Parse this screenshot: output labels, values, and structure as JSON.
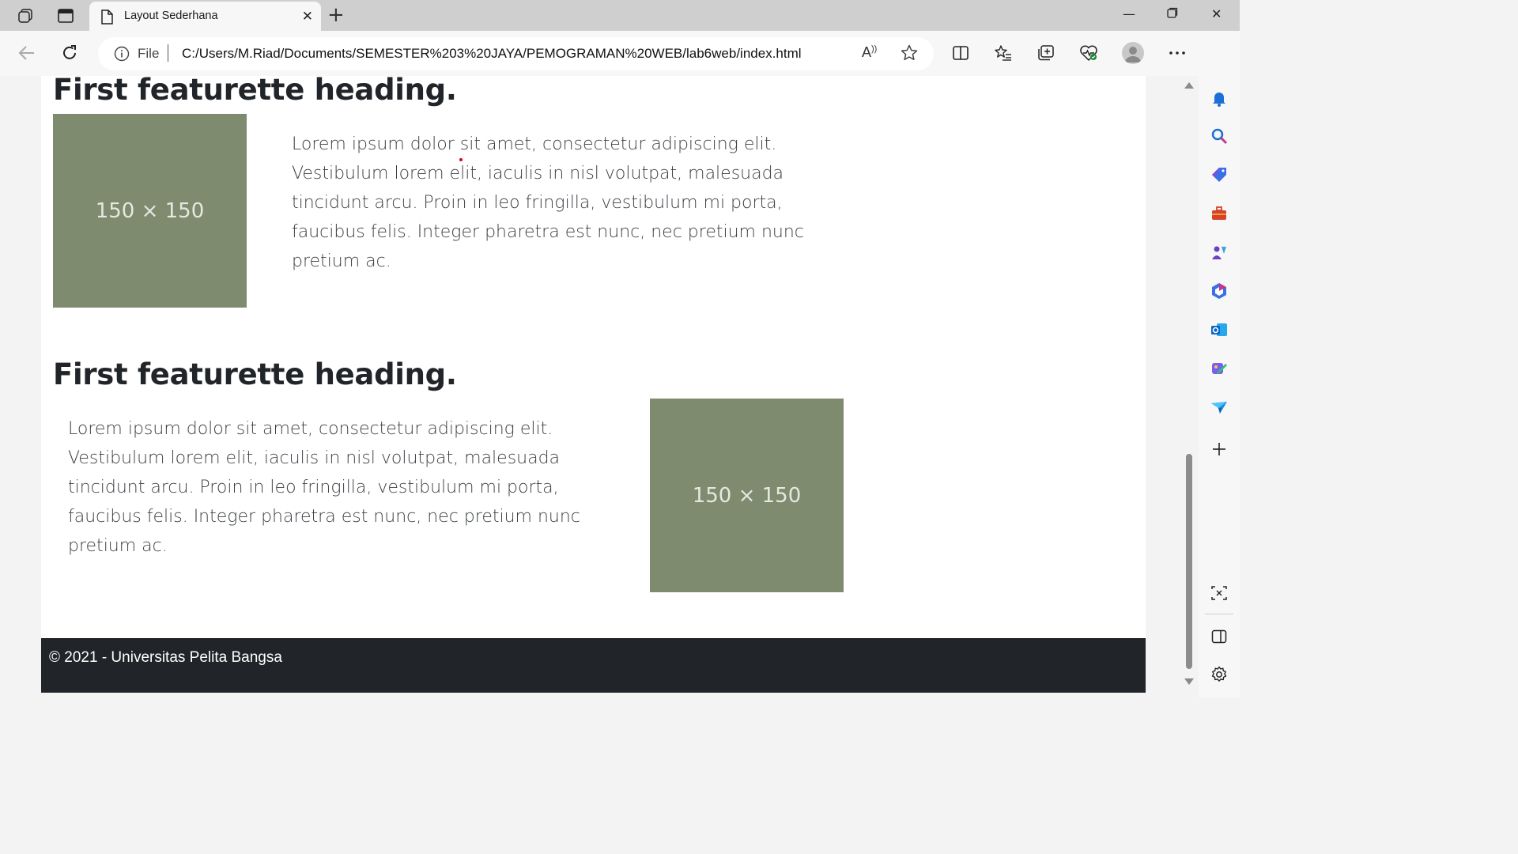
{
  "browser": {
    "tab": {
      "title": "Layout Sederhana"
    },
    "address": {
      "scheme_label": "File",
      "url": "C:/Users/M.Riad/Documents/SEMESTER%203%20JAYA/PEMOGRAMAN%20WEB/lab6web/index.html",
      "read_aloud": "Ḁ̂"
    }
  },
  "page": {
    "featurette1": {
      "heading": "First featurette heading.",
      "image_label": "150 × 150",
      "text": "Lorem ipsum dolor sit amet, consectetur adipiscing elit. Vestibulum lorem elit, iaculis in nisl volutpat, malesuada tincidunt arcu. Proin in leo fringilla, vestibulum mi porta, faucibus felis. Integer pharetra est nunc, nec pretium nunc pretium ac."
    },
    "featurette2": {
      "heading": "First featurette heading.",
      "image_label": "150 × 150",
      "text": "Lorem ipsum dolor sit amet, consectetur adipiscing elit. Vestibulum lorem elit, iaculis in nisl volutpat, malesuada tincidunt arcu. Proin in leo fringilla, vestibulum mi porta, faucibus felis. Integer pharetra est nunc, nec pretium nunc pretium ac."
    },
    "footer": {
      "text": "© 2021 - Universitas Pelita Bangsa"
    }
  },
  "colors": {
    "placeholder": "#7e8b6f",
    "footer_bg": "#212529",
    "accent": "#0078d4"
  },
  "icons": {
    "tabbar": [
      "workspaces-icon",
      "tab-actions-icon",
      "page-icon",
      "close-icon",
      "new-tab-icon"
    ],
    "window": [
      "minimize-icon",
      "restore-icon",
      "close-window-icon"
    ],
    "toolbar": [
      "back-icon",
      "refresh-icon",
      "info-icon",
      "read-aloud-icon",
      "favorite-star-icon",
      "split-screen-icon",
      "favorites-icon",
      "collections-icon",
      "browser-essentials-icon",
      "profile-icon",
      "more-icon",
      "copilot-icon"
    ],
    "sidebar": [
      "notification-icon",
      "search-icon",
      "shopping-icon",
      "tools-icon",
      "games-icon",
      "microsoft-365-icon",
      "outlook-icon",
      "designer-icon",
      "drop-icon",
      "add-icon",
      "screenshot-icon",
      "sidebar-toggle-icon",
      "settings-icon"
    ]
  }
}
